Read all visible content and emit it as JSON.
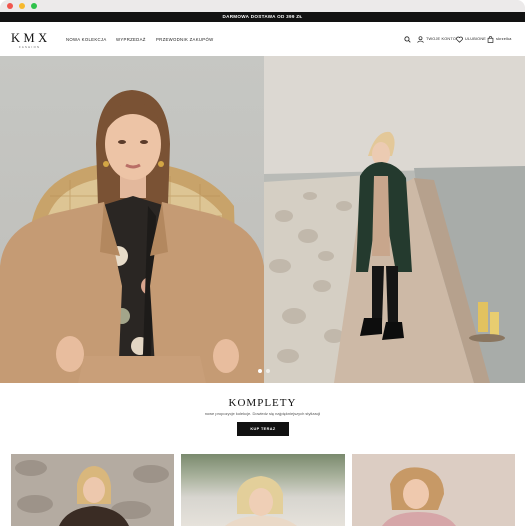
{
  "window": {
    "controls": [
      "close",
      "minimize",
      "maximize"
    ]
  },
  "promo_bar": {
    "text": "DARMOWA DOSTAWA OD 399 ZŁ"
  },
  "header": {
    "logo": "KMX",
    "logo_sub": "FASHION",
    "nav": [
      "NOWA KOLEKCJA",
      "WYPRZEDAŻ",
      "PRZEWODNIK ZAKUPÓW"
    ],
    "account_label": "TWOJE KONTO",
    "wishlist_label": "ULUBIONE",
    "cart_label": "skrzelka",
    "icons": [
      "search-icon",
      "user-icon",
      "heart-icon",
      "bag-icon"
    ]
  },
  "hero": {
    "slides_total": 2,
    "active_slide": 1
  },
  "section": {
    "title": "KOMPLETY",
    "subtitle": "nowe propozycje kolekcje. Dowiedz się najpiękniejszych stylizacji",
    "cta_label": "KUP TERAZ"
  },
  "colors": {
    "promo_bg": "#121212",
    "cta_bg": "#111111",
    "camel_blazer": "#c59b74",
    "coat_green": "#243a2e"
  }
}
